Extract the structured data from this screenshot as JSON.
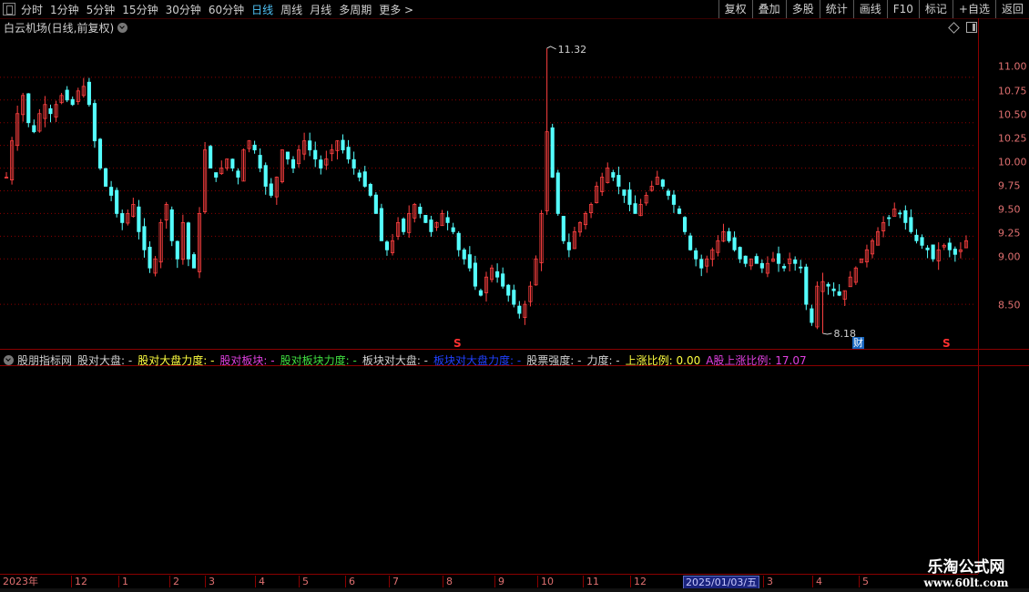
{
  "toolbar": {
    "periods": [
      "分时",
      "1分钟",
      "5分钟",
      "15分钟",
      "30分钟",
      "60分钟",
      "日线",
      "周线",
      "月线",
      "多周期",
      "更多 >"
    ],
    "active_period": "日线",
    "buttons": [
      "复权",
      "叠加",
      "多股",
      "统计",
      "画线",
      "F10",
      "标记",
      "+自选",
      "返回"
    ]
  },
  "chart_title": "白云机场(日线,前复权)",
  "price_axis": [
    "11.00",
    "10.75",
    "10.50",
    "10.25",
    "10.00",
    "9.75",
    "9.50",
    "9.25",
    "9.00",
    "8.50"
  ],
  "annotations": {
    "high_label": "11.32",
    "low_label": "8.18",
    "s_marker": "S",
    "cai_marker": "财"
  },
  "indicator": {
    "name": "股朋指标网",
    "items": [
      {
        "text": "股对大盘: -",
        "color": "#d0d0d0"
      },
      {
        "text": "股对大盘力度: -",
        "color": "#ffff40"
      },
      {
        "text": "股对板块: -",
        "color": "#e040e0"
      },
      {
        "text": "股对板块力度: -",
        "color": "#40e040"
      },
      {
        "text": "板块对大盘: -",
        "color": "#d0d0d0"
      },
      {
        "text": "板块对大盘力度: -",
        "color": "#2040ff"
      },
      {
        "text": "股票强度: -",
        "color": "#d0d0d0"
      },
      {
        "text": "力度: -",
        "color": "#d0d0d0"
      },
      {
        "text": "上涨比例: 0.00",
        "color": "#ffff40"
      },
      {
        "text": "A股上涨比例: 17.07",
        "color": "#e040e0"
      }
    ]
  },
  "date_axis": [
    "2023年",
    "12",
    "1",
    "2",
    "3",
    "4",
    "5",
    "6",
    "7",
    "8",
    "9",
    "10",
    "11",
    "12",
    "3",
    "4",
    "5"
  ],
  "current_date": "2025/01/03/五",
  "watermark": {
    "line1": "乐淘公式网",
    "line2": "www.60lt.com"
  },
  "colors": {
    "up": "#ff4040",
    "down": "#54ffff",
    "grid": "#8b0000",
    "axis_text": "#e07070"
  },
  "chart_data": {
    "type": "candlestick",
    "ylim": [
      8.1,
      11.45
    ],
    "closes": [
      9.9,
      10.3,
      10.6,
      10.8,
      10.5,
      10.4,
      10.6,
      10.7,
      10.6,
      10.7,
      10.8,
      10.75,
      10.7,
      10.85,
      10.9,
      10.7,
      10.3,
      10.0,
      9.8,
      9.7,
      9.5,
      9.4,
      9.5,
      9.6,
      9.3,
      9.1,
      8.9,
      9.0,
      9.4,
      9.6,
      9.2,
      9.0,
      9.4,
      9.0,
      8.9,
      9.5,
      10.2,
      10.0,
      9.9,
      10.0,
      10.1,
      10.0,
      9.9,
      10.2,
      10.3,
      10.2,
      10.0,
      9.8,
      9.7,
      9.9,
      10.2,
      10.1,
      10.0,
      10.2,
      10.3,
      10.2,
      10.1,
      10.0,
      10.1,
      10.2,
      10.3,
      10.2,
      10.1,
      10.0,
      9.9,
      9.8,
      9.7,
      9.5,
      9.2,
      9.1,
      9.2,
      9.4,
      9.3,
      9.5,
      9.6,
      9.5,
      9.4,
      9.3,
      9.4,
      9.5,
      9.4,
      9.3,
      9.1,
      9.0,
      8.9,
      8.7,
      8.6,
      8.8,
      8.9,
      8.8,
      8.7,
      8.6,
      8.5,
      8.4,
      8.5,
      8.7,
      9.0,
      9.5,
      10.4,
      9.9,
      9.5,
      9.2,
      9.1,
      9.3,
      9.4,
      9.5,
      9.6,
      9.8,
      9.9,
      10.0,
      9.9,
      9.8,
      9.7,
      9.6,
      9.5,
      9.6,
      9.7,
      9.8,
      9.9,
      9.8,
      9.7,
      9.6,
      9.5,
      9.3,
      9.1,
      9.0,
      8.9,
      9.0,
      9.1,
      9.2,
      9.3,
      9.2,
      9.1,
      9.0,
      8.95,
      9.0,
      8.95,
      8.9,
      8.95,
      9.0,
      8.95,
      8.9,
      9.0,
      8.95,
      8.9,
      8.5,
      8.3,
      8.7,
      8.75,
      8.7,
      8.65,
      8.6,
      8.65,
      8.8,
      8.9,
      9.0,
      9.1,
      9.2,
      9.3,
      9.4,
      9.45,
      9.55,
      9.5,
      9.4,
      9.3,
      9.2,
      9.15,
      9.1,
      9.0,
      9.1,
      9.15,
      9.1,
      9.05,
      9.1,
      9.2
    ]
  }
}
